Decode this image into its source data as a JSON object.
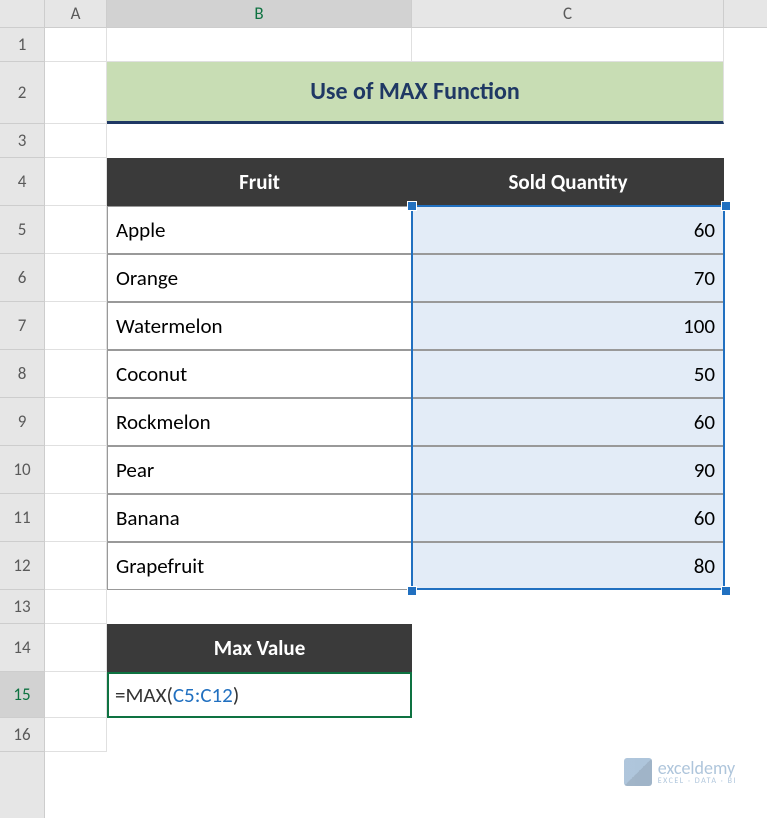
{
  "columns": [
    "A",
    "B",
    "C"
  ],
  "rows": [
    "1",
    "2",
    "3",
    "4",
    "5",
    "6",
    "7",
    "8",
    "9",
    "10",
    "11",
    "12",
    "13",
    "14",
    "15",
    "16"
  ],
  "title": "Use of MAX Function",
  "table": {
    "headers": [
      "Fruit",
      "Sold Quantity"
    ],
    "data": [
      {
        "fruit": "Apple",
        "qty": "60"
      },
      {
        "fruit": "Orange",
        "qty": "70"
      },
      {
        "fruit": "Watermelon",
        "qty": "100"
      },
      {
        "fruit": "Coconut",
        "qty": "50"
      },
      {
        "fruit": "Rockmelon",
        "qty": "60"
      },
      {
        "fruit": "Pear",
        "qty": "90"
      },
      {
        "fruit": "Banana",
        "qty": "60"
      },
      {
        "fruit": "Grapefruit",
        "qty": "80"
      }
    ]
  },
  "maxLabel": "Max Value",
  "formula": {
    "equals": "=",
    "func": "MAX",
    "open": "(",
    "ref": "C5:C12",
    "close": ")"
  },
  "watermark": {
    "name": "exceldemy",
    "tagline": "EXCEL · DATA · BI"
  },
  "dimensions": {
    "colA": 62,
    "colB": 305,
    "colC": 312,
    "row1": 34,
    "row2": 62,
    "row3": 34,
    "rowHeader": 48,
    "rowData": 48,
    "row13": 34,
    "row14": 48,
    "row15": 46,
    "row16": 34
  }
}
